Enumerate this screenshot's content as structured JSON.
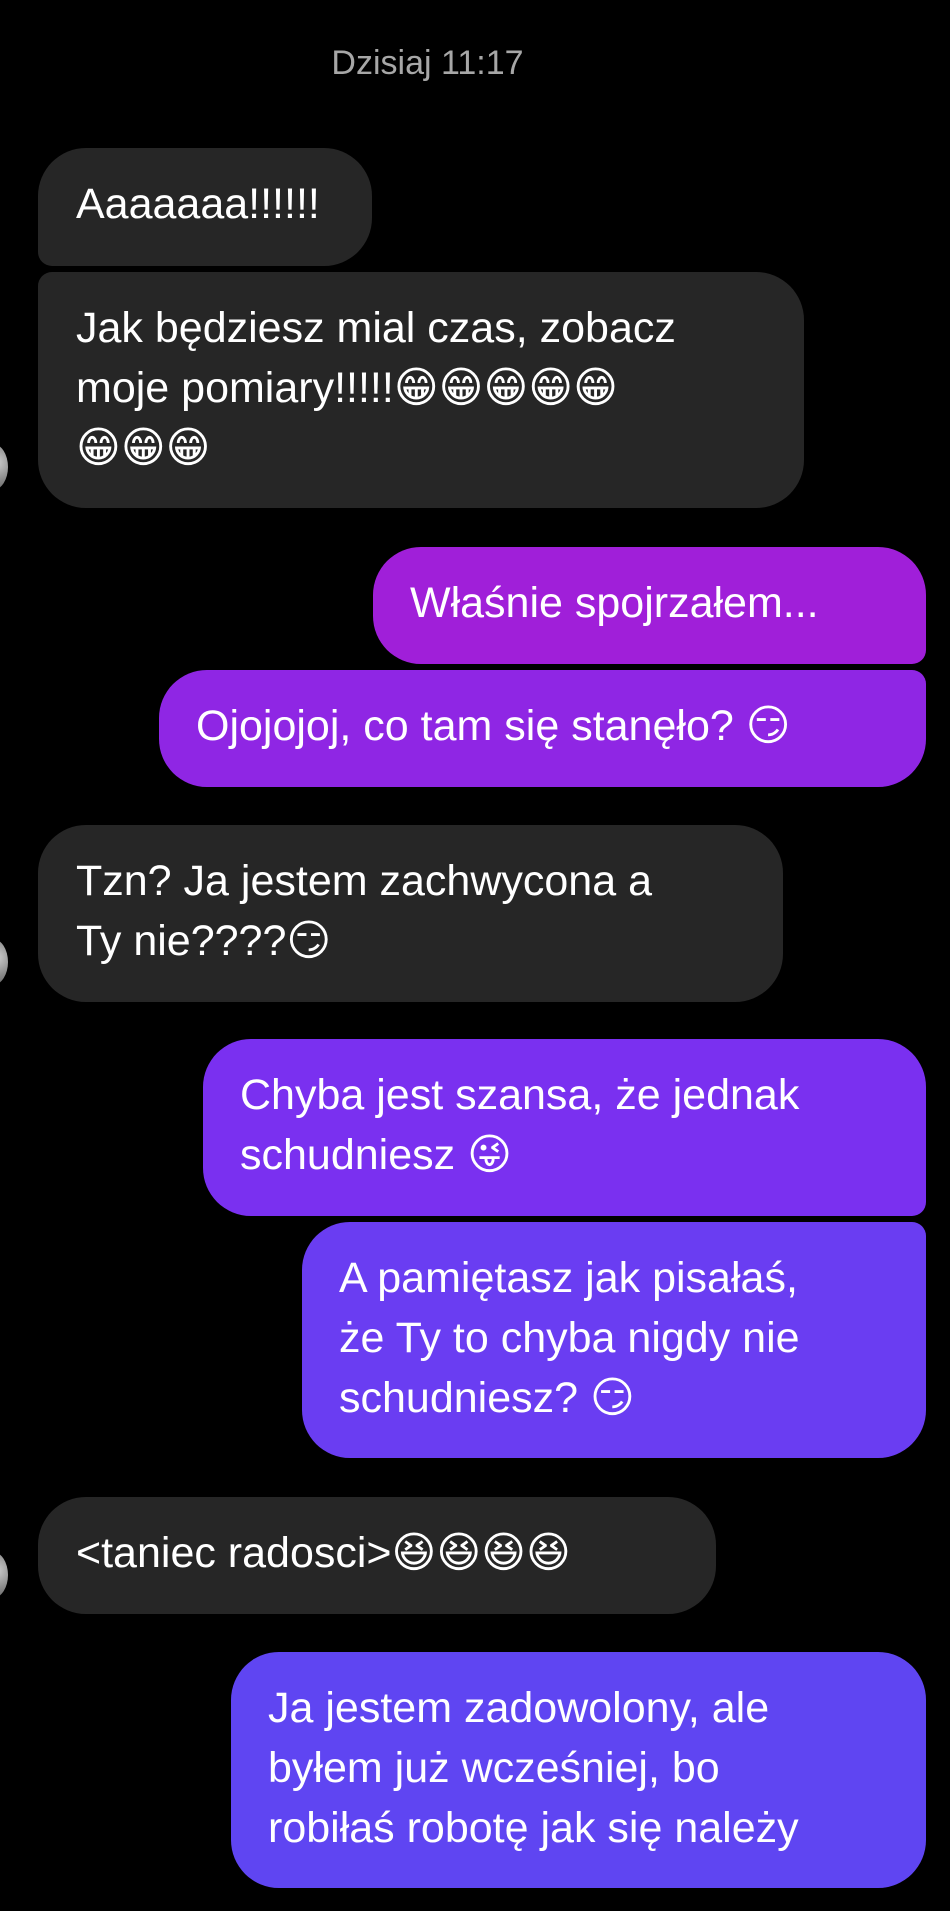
{
  "timestamp": "Dzisiaj 11:17",
  "messages": [
    {
      "direction": "incoming",
      "text": "Aaaaaaa!!!!!!"
    },
    {
      "direction": "incoming",
      "text": "Jak będziesz mial czas, zobacz\nmoje pomiary!!!!!😁😁😁😁😁\n😁😁😁"
    },
    {
      "direction": "outgoing",
      "text": "Właśnie spojrzałem..."
    },
    {
      "direction": "outgoing",
      "text": "Ojojojoj, co tam się stanęło? 😏"
    },
    {
      "direction": "incoming",
      "text": "Tzn? Ja jestem zachwycona a\nTy nie????😏"
    },
    {
      "direction": "outgoing",
      "text": "Chyba jest szansa, że jednak\nschudniesz 😜"
    },
    {
      "direction": "outgoing",
      "text": "A pamiętasz jak pisałaś,\nże Ty to chyba nigdy nie\nschudniesz? 😏"
    },
    {
      "direction": "incoming",
      "text": "<taniec radosci>😆😆😆😆"
    },
    {
      "direction": "outgoing",
      "text": "Ja jestem zadowolony, ale\nbyłem już wcześniej, bo\nrobiłaś robotę jak się należy"
    }
  ],
  "colors": {
    "background": "#000000",
    "incoming_bubble": "#262626",
    "outgoing_gradient_top": "#a01fd9",
    "outgoing_gradient_mid": "#7a30f0",
    "outgoing_gradient_bottom": "#5f45f2",
    "timestamp_text": "#a7a7a7"
  }
}
